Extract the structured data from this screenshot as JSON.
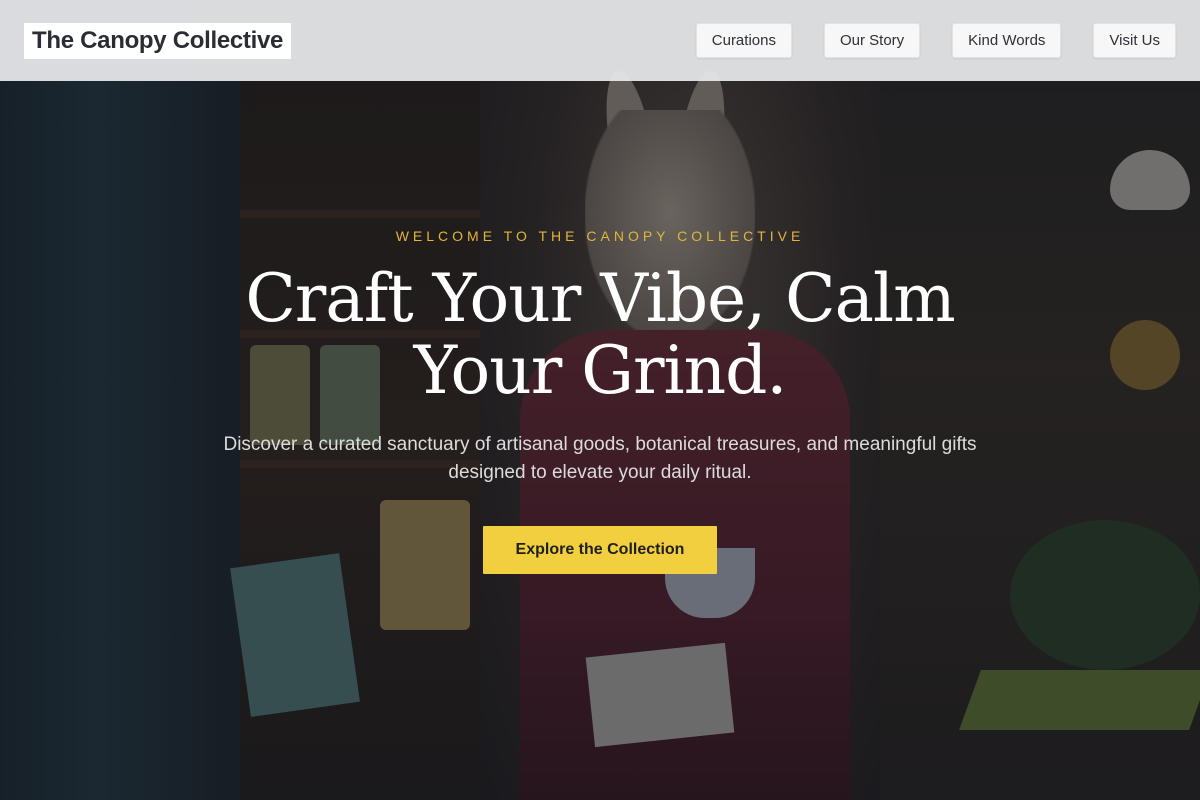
{
  "header": {
    "brand": "The Canopy Collective",
    "nav": [
      {
        "label": "Curations"
      },
      {
        "label": "Our Story"
      },
      {
        "label": "Kind Words"
      },
      {
        "label": "Visit Us"
      }
    ]
  },
  "hero": {
    "eyebrow": "WELCOME TO THE CANOPY COLLECTIVE",
    "headline": "Craft Your Vibe, Calm Your Grind.",
    "subtext": "Discover a curated sanctuary of artisanal goods, botanical treasures, and meaningful gifts designed to elevate your daily ritual.",
    "cta_label": "Explore the Collection"
  },
  "colors": {
    "accent": "#f2cf3e",
    "eyebrow": "#e1b43a",
    "header_bg": "#e8eaec",
    "overlay": "#12141a"
  }
}
